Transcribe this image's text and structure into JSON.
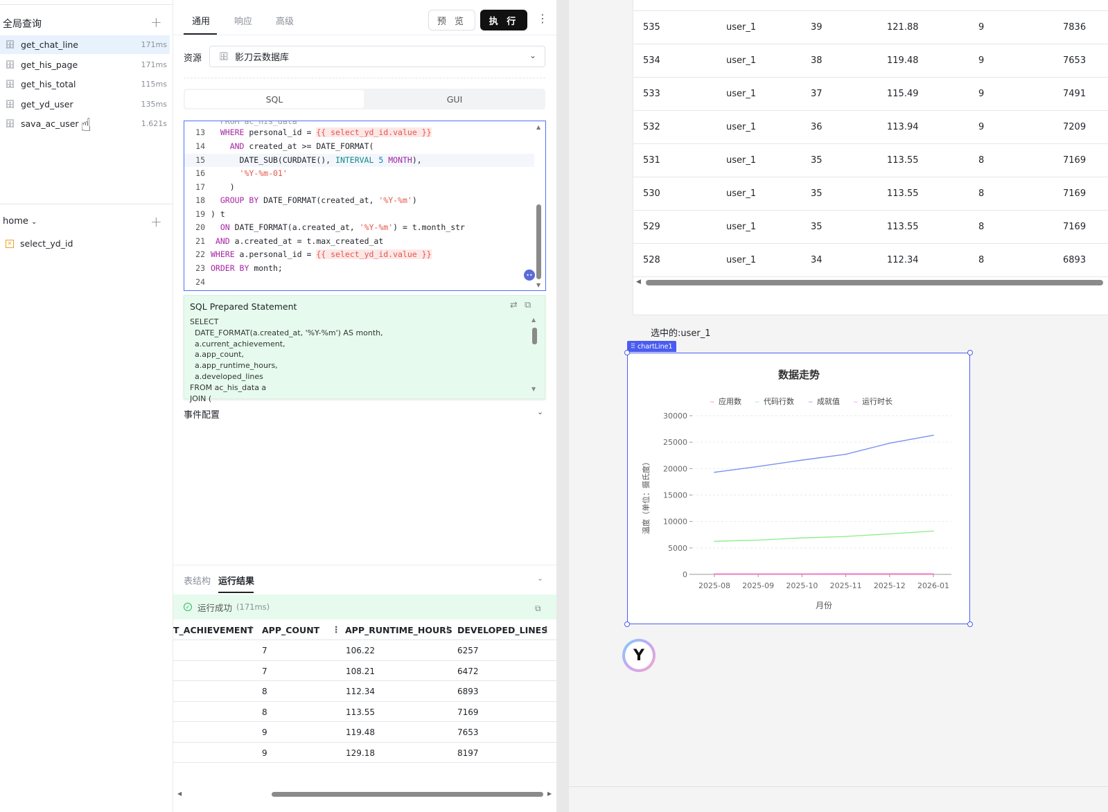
{
  "left": {
    "global_title": "全局查询",
    "queries": [
      {
        "name": "get_chat_line",
        "time": "171ms"
      },
      {
        "name": "get_his_page",
        "time": "171ms"
      },
      {
        "name": "get_his_total",
        "time": "115ms"
      },
      {
        "name": "get_yd_user",
        "time": "135ms"
      },
      {
        "name": "sava_ac_user",
        "time": "1.621s"
      }
    ],
    "home_title": "home",
    "home_items": [
      {
        "name": "select_yd_id"
      }
    ]
  },
  "mid": {
    "tabs": [
      "通用",
      "响应",
      "高级"
    ],
    "preview_label": "预 览",
    "execute_label": "执 行",
    "resource_label": "资源",
    "resource_value": "影刀云数据库",
    "modes": [
      "SQL",
      "GUI"
    ],
    "editor_line_numbers": [
      "13",
      "14",
      "15",
      "16",
      "17",
      "18",
      "19",
      "20",
      "21",
      "22",
      "23",
      "24"
    ],
    "prepared_title": "SQL Prepared Statement",
    "prepared_body": "SELECT\n  DATE_FORMAT(a.created_at, '%Y-%m') AS month,\n  a.current_achievement,\n  a.app_count,\n  a.app_runtime_hours,\n  a.developed_lines\nFROM ac_his_data a\nJOIN (",
    "event_label": "事件配置"
  },
  "bottom": {
    "tabs": [
      "表结构",
      "运行结果"
    ],
    "success_text": "运行成功",
    "success_time": "(171ms)",
    "columns": [
      "T_ACHIEVEMENT",
      "APP_COUNT",
      "APP_RUNTIME_HOURS",
      "DEVELOPED_LINES"
    ],
    "rows": [
      {
        "app_count": "7",
        "hours": "106.22",
        "lines": "6257"
      },
      {
        "app_count": "7",
        "hours": "108.21",
        "lines": "6472"
      },
      {
        "app_count": "8",
        "hours": "112.34",
        "lines": "6893"
      },
      {
        "app_count": "8",
        "hours": "113.55",
        "lines": "7169"
      },
      {
        "app_count": "9",
        "hours": "119.48",
        "lines": "7653"
      },
      {
        "app_count": "9",
        "hours": "129.18",
        "lines": "8197"
      }
    ]
  },
  "right": {
    "table_rows": [
      {
        "id": "535",
        "user": "user_1",
        "a": "39",
        "b": "121.88",
        "c": "9",
        "d": "7836"
      },
      {
        "id": "534",
        "user": "user_1",
        "a": "38",
        "b": "119.48",
        "c": "9",
        "d": "7653"
      },
      {
        "id": "533",
        "user": "user_1",
        "a": "37",
        "b": "115.49",
        "c": "9",
        "d": "7491"
      },
      {
        "id": "532",
        "user": "user_1",
        "a": "36",
        "b": "113.94",
        "c": "9",
        "d": "7209"
      },
      {
        "id": "531",
        "user": "user_1",
        "a": "35",
        "b": "113.55",
        "c": "8",
        "d": "7169"
      },
      {
        "id": "530",
        "user": "user_1",
        "a": "35",
        "b": "113.55",
        "c": "8",
        "d": "7169"
      },
      {
        "id": "529",
        "user": "user_1",
        "a": "35",
        "b": "113.55",
        "c": "8",
        "d": "7169"
      },
      {
        "id": "528",
        "user": "user_1",
        "a": "34",
        "b": "112.34",
        "c": "8",
        "d": "6893"
      }
    ],
    "selected_label": "选中的:user_1",
    "chart_chip": "chartLine1"
  },
  "chart_data": {
    "type": "line",
    "title": "数据走势",
    "xlabel": "月份",
    "ylabel": "温度（单位：摄氏度）",
    "categories": [
      "2025-08",
      "2025-09",
      "2025-10",
      "2025-11",
      "2025-12",
      "2026-01"
    ],
    "ylim": [
      0,
      30000
    ],
    "yticks": [
      "0",
      "5000",
      "10000",
      "15000",
      "20000",
      "25000",
      "30000"
    ],
    "grid": true,
    "legend_position": "top",
    "series": [
      {
        "name": "应用数",
        "color": "#f08080",
        "values": [
          7,
          7,
          8,
          8,
          9,
          9
        ]
      },
      {
        "name": "代码行数",
        "color": "#90ee90",
        "values": [
          6257,
          6472,
          6893,
          7169,
          7653,
          8197
        ]
      },
      {
        "name": "成就值",
        "color": "#7b8ff0",
        "values": [
          19300,
          20400,
          21600,
          22700,
          24800,
          26300
        ]
      },
      {
        "name": "运行时长",
        "color": "#ee82ee",
        "values": [
          106.22,
          108.21,
          112.34,
          113.55,
          119.48,
          129.18
        ]
      }
    ]
  }
}
